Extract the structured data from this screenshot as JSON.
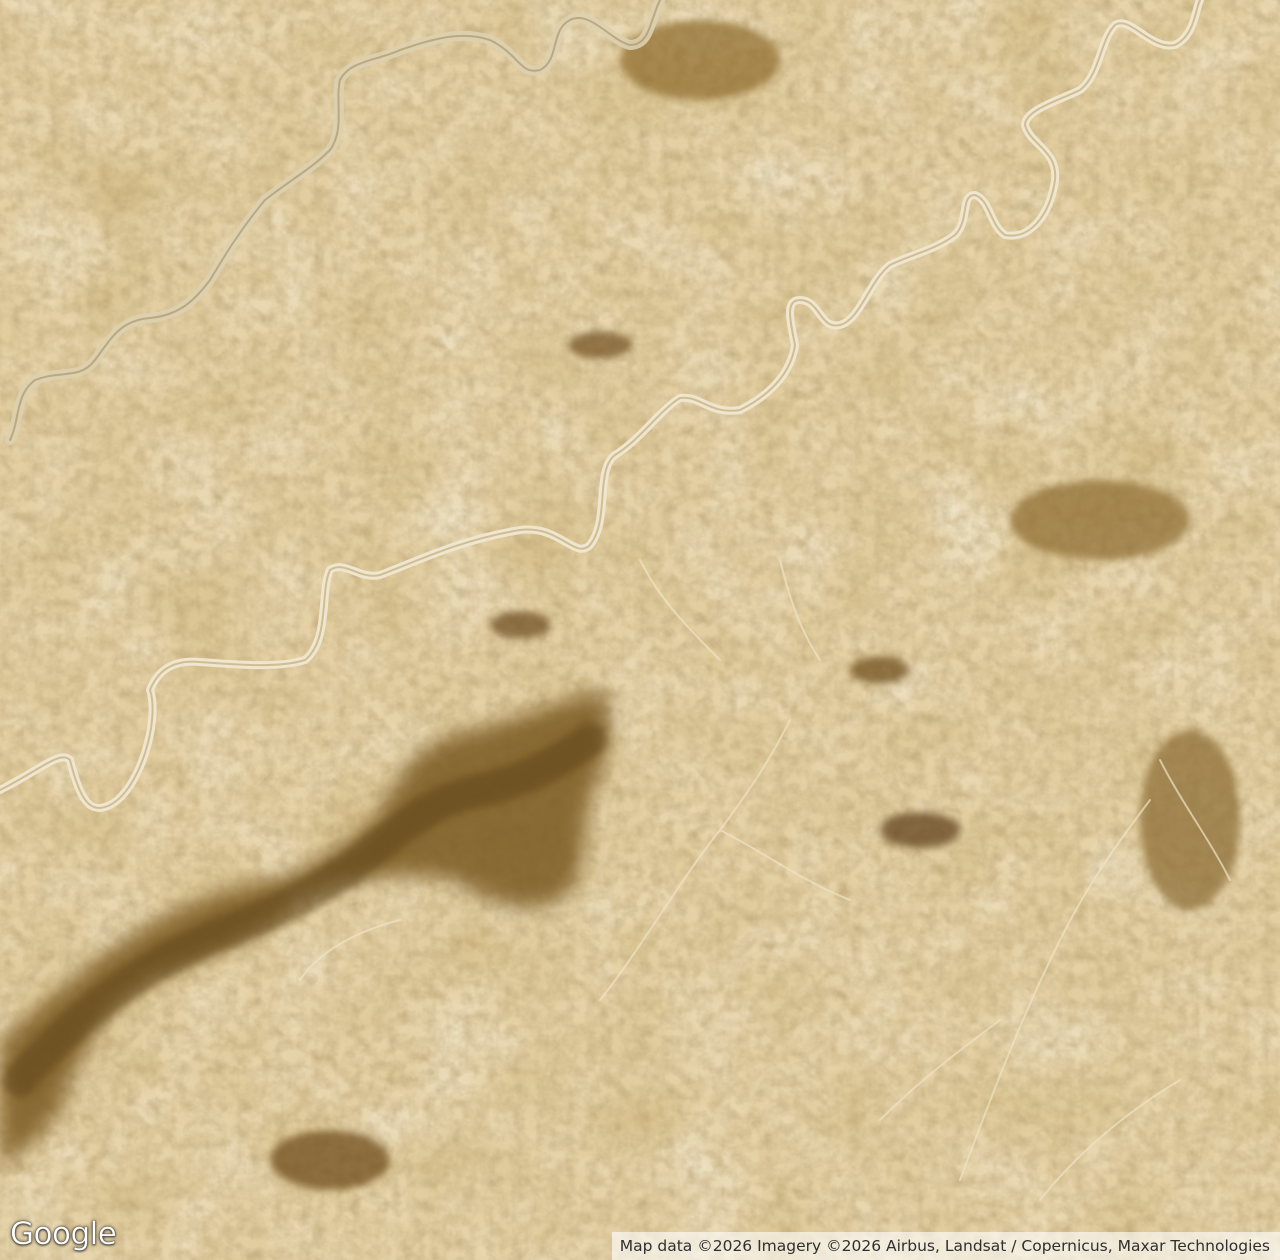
{
  "map": {
    "type": "satellite",
    "palette": {
      "terrain_light": "#e4d6b4",
      "terrain_mid": "#c9a668",
      "terrain_dark": "#8a6428",
      "river_bed": "#ede4cc",
      "valley_shadow": "#6f5222"
    }
  },
  "branding": {
    "logo_text": "Google"
  },
  "attribution": {
    "text": "Map data ©2026 Imagery ©2026 Airbus, Landsat / Copernicus, Maxar Technologies"
  }
}
